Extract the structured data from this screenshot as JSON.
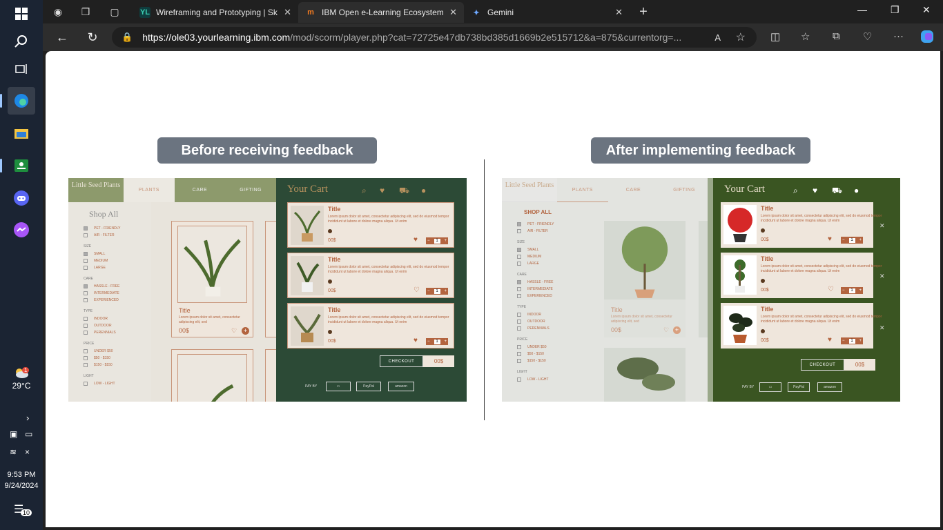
{
  "taskbar": {
    "weather_temp": "29°C",
    "weather_alert": "1",
    "clock_time": "9:53 PM",
    "clock_date": "9/24/2024",
    "notifications": "10",
    "icons": [
      "windows-icon",
      "search-icon",
      "task-view-icon",
      "edge-icon",
      "file-explorer-icon",
      "classroom-icon",
      "discord-icon",
      "messenger-icon"
    ]
  },
  "browser": {
    "tabs": [
      {
        "title": "Wireframing and Prototyping | Sk",
        "fav": "YL"
      },
      {
        "title": "IBM Open e-Learning Ecosystem",
        "fav": "m"
      },
      {
        "title": "Gemini",
        "fav": "✦"
      }
    ],
    "url_host": "https://ole03.yourlearning.ibm.com",
    "url_path": "/mod/scorm/player.php?cat=72725e47db738bd385d1669b2e515712&a=875&currentorg=..."
  },
  "slide": {
    "before_label": "Before receiving feedback",
    "after_label": "After implementing feedback"
  },
  "mock": {
    "brand": "Little Seed Plants",
    "nav": [
      "PLANTS",
      "CARE",
      "GIFTING"
    ],
    "shop_all": "Shop All",
    "shop_all_after": "SHOP ALL",
    "filters": {
      "use": [
        "PET - FRIENDLY",
        "AIR - FILTER"
      ],
      "size_h": "SIZE",
      "size": [
        "SMALL",
        "MEDIUM",
        "LARGE"
      ],
      "care_h": "CARE",
      "care": [
        "HASSLE - FREE",
        "INTERMEDIATE",
        "EXPERIENCED"
      ],
      "type_h": "TYPE",
      "type": [
        "INDOOR",
        "OUTDOOR",
        "PERENNIALS"
      ],
      "price_h": "PRICE",
      "price": [
        "UNDER $50",
        "$50 - $150",
        "$150 - $150"
      ],
      "light_h": "LIGHT",
      "light": [
        "LOW - LIGHT"
      ]
    },
    "product": {
      "title": "Title",
      "desc": "Lorem ipsum dolor sit amet, consectetur adipiscing elit, sed",
      "price": "00$"
    },
    "cart_title": "Your Cart",
    "cart_item": {
      "title": "Title",
      "desc": "Lorem ipsum dolor sit amet, consectetur adipiscing elit, sed do eiusmod tempor incididunt ut labore et dolore magna aliqua. Ut enim",
      "price": "00$",
      "qty": "1"
    },
    "checkout": "CHECKOUT",
    "checkout_total": "00$",
    "pay_by": "PAY BY",
    "pay_methods": [
      "▭",
      "PayPal",
      "amazon"
    ]
  }
}
